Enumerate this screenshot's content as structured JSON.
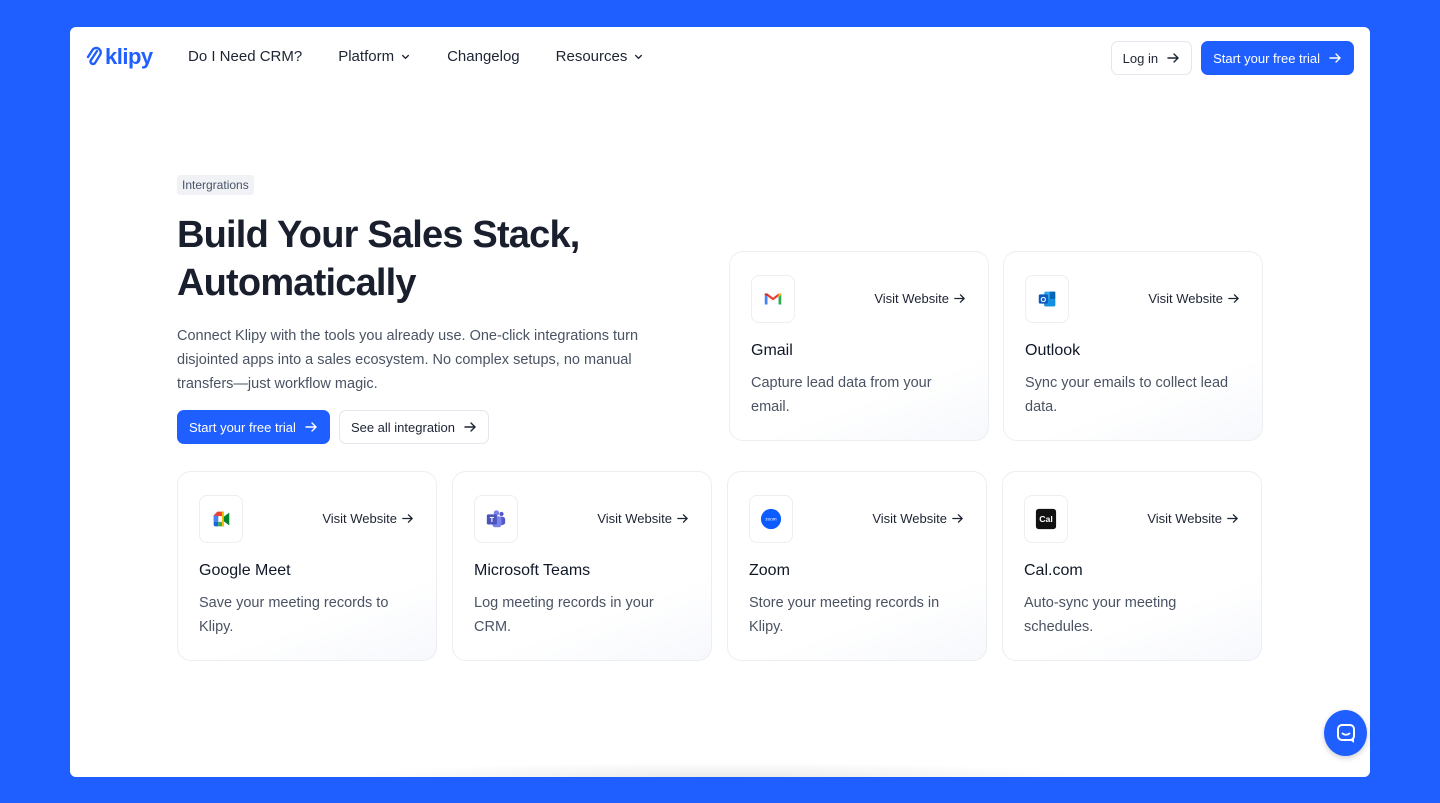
{
  "nav": {
    "logo_text": "klipy",
    "links": [
      {
        "label": "Do I Need CRM?"
      },
      {
        "label": "Platform"
      },
      {
        "label": "Changelog"
      },
      {
        "label": "Resources"
      }
    ],
    "login_label": "Log in",
    "trial_label": "Start your free trial"
  },
  "hero": {
    "tag": "Intergrations",
    "headline_line1": "Build Your Sales Stack,",
    "headline_line2": "Automatically",
    "subtext": "Connect Klipy with the tools you already use. One-click integrations turn disjointed apps into a sales ecosystem. No complex setups, no manual transfers—just workflow magic.",
    "cta_primary": "Start your free trial",
    "cta_secondary": "See all integration"
  },
  "cards": [
    {
      "name": "Gmail",
      "visit": "Visit Website",
      "desc": "Capture lead data from your email."
    },
    {
      "name": "Outlook",
      "visit": "Visit Website",
      "desc": "Sync your emails to collect lead data."
    },
    {
      "name": "Google Meet",
      "visit": "Visit Website",
      "desc": "Save your meeting records to Klipy."
    },
    {
      "name": "Microsoft Teams",
      "visit": "Visit Website",
      "desc": "Log meeting records in your CRM."
    },
    {
      "name": "Zoom",
      "visit": "Visit Website",
      "desc": "Store your meeting records in Klipy."
    },
    {
      "name": "Cal.com",
      "visit": "Visit Website",
      "desc": "Auto-sync your meeting schedules."
    }
  ],
  "icons": {
    "zoom_label": "zoom",
    "cal_label": "Cal",
    "outlook_label": "O",
    "teams_label": "T"
  },
  "colors": {
    "brand": "#1f5eff",
    "text": "#101828",
    "muted": "#4a5363"
  }
}
